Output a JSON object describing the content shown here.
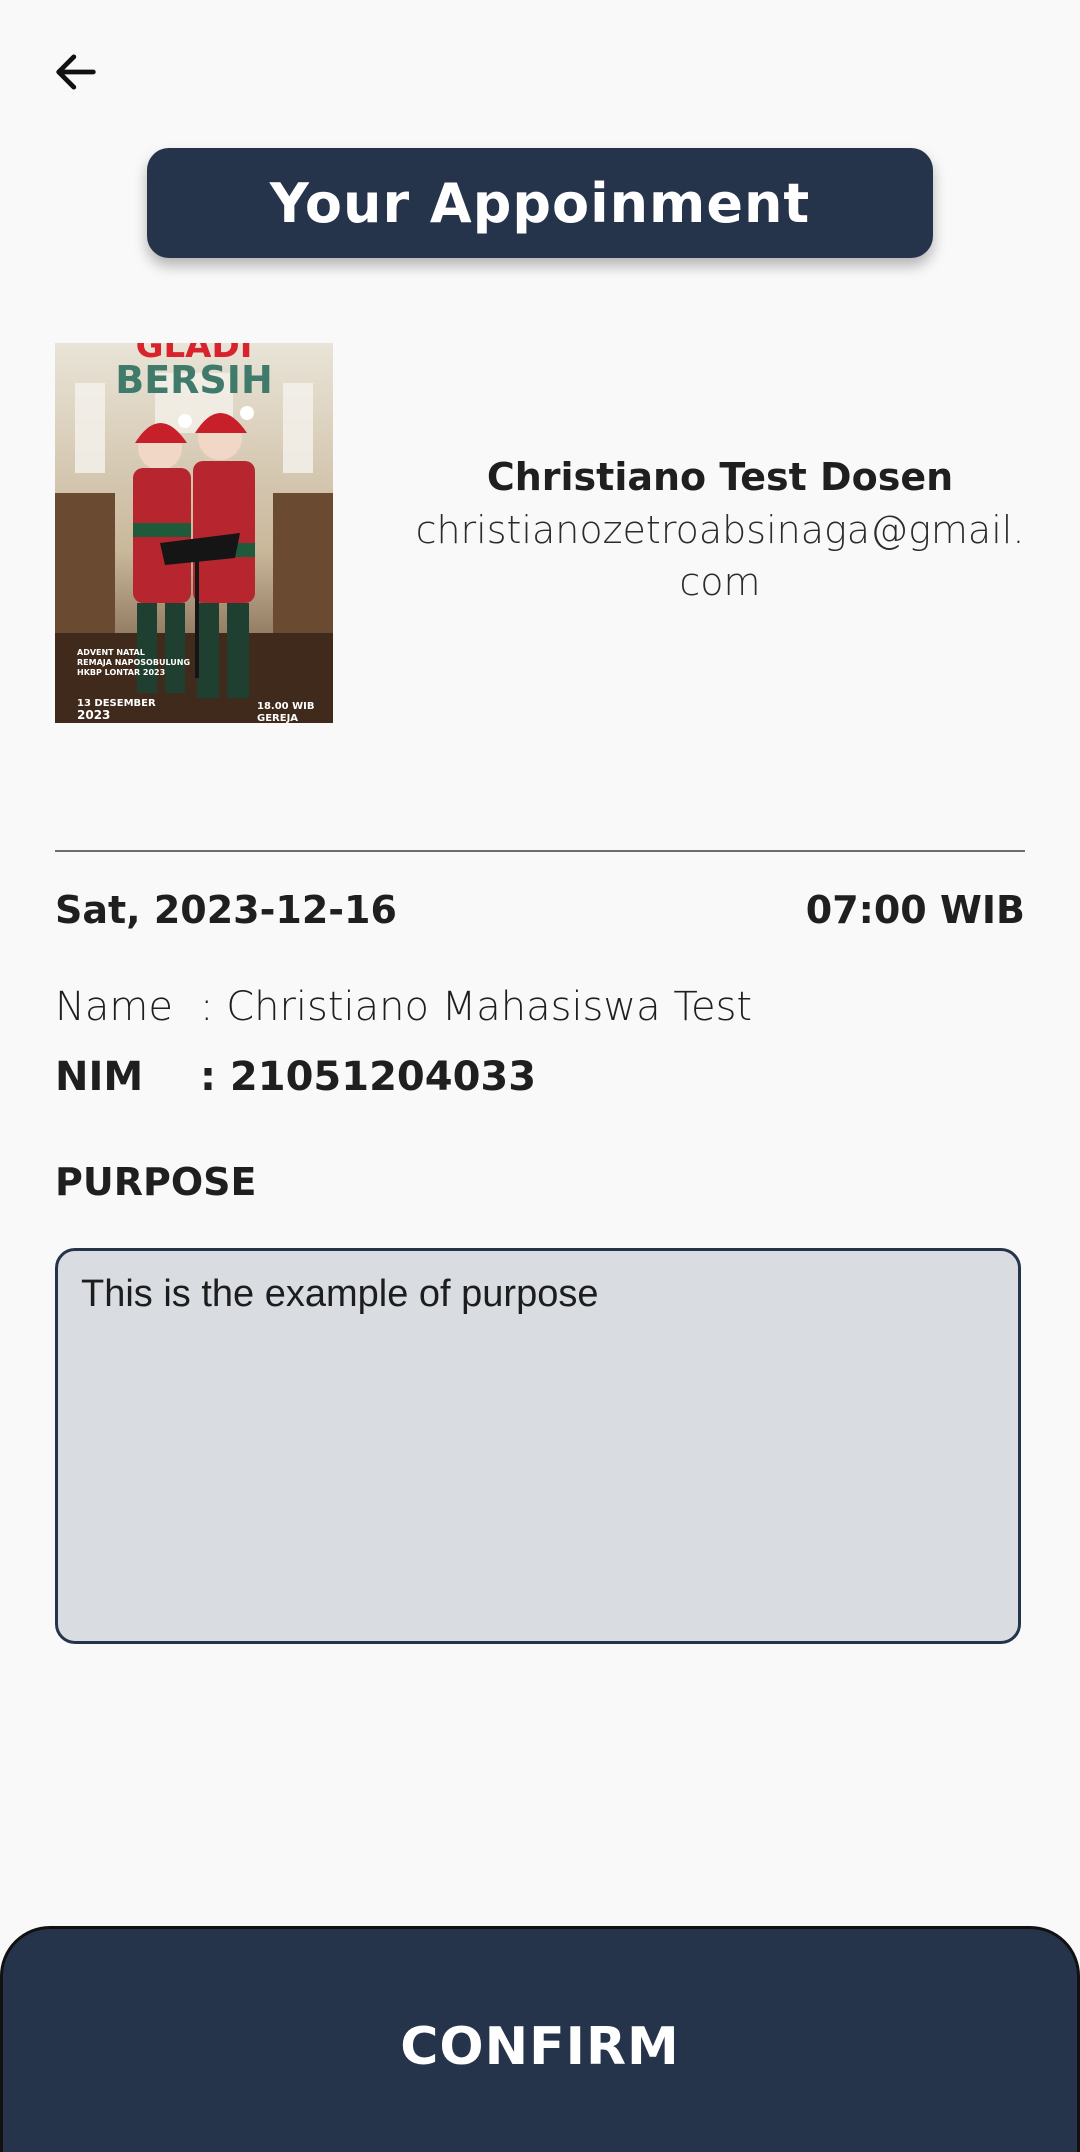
{
  "header": {
    "back_icon": "arrow-left-icon",
    "title": "Your Appoinment"
  },
  "lecturer": {
    "name": "Christiano Test Dosen",
    "email": "christianozetroabsinaga@gmail.com"
  },
  "poster": {
    "heading_top": "GLADI",
    "heading": "BERSIH",
    "caption_lines": [
      "ADVENT NATAL",
      "REMAJA NAPOSOBULUNG",
      "HKBP LONTAR 2023"
    ],
    "date_line1": "13 DESEMBER",
    "date_line2": "2023",
    "time_line1": "18.00 WIB",
    "time_line2": "GEREJA"
  },
  "appointment": {
    "date": "Sat, 2023-12-16",
    "time": "07:00 WIB",
    "name_label": "Name",
    "name_value": ": Christiano Mahasiswa Test",
    "nim_label": "NIM",
    "nim_value": ": 21051204033",
    "purpose_heading": "PURPOSE",
    "purpose_text": "This is the example of purpose"
  },
  "actions": {
    "confirm_label": "CONFIRM"
  },
  "colors": {
    "primary": "#26344b",
    "background": "#f9f9f9",
    "purpose_fill": "#d9dde2"
  }
}
